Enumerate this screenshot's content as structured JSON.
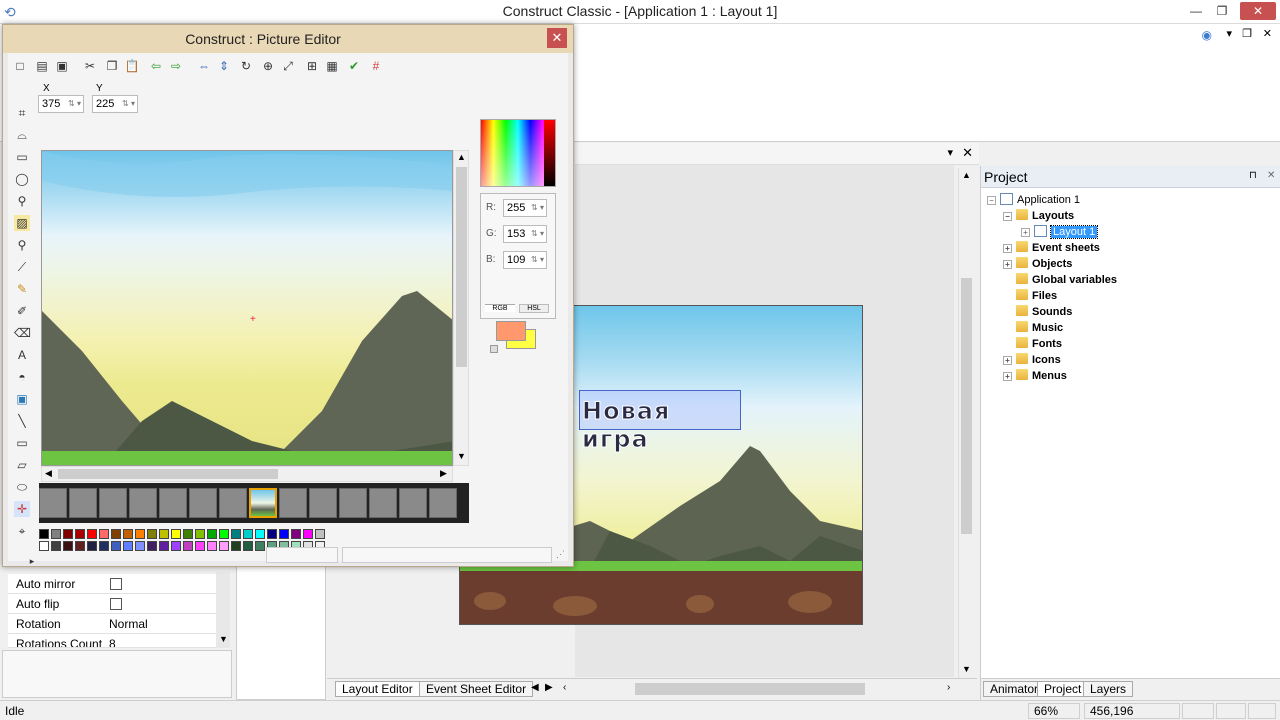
{
  "window": {
    "title": "Construct Classic - [Application 1 : Layout 1]",
    "minimize": "—",
    "maximize": "❐",
    "close": "✕"
  },
  "ribbon": {
    "help": "◉",
    "min": "▾",
    "restore": "❐",
    "close": "✕"
  },
  "picture_editor": {
    "title": "Construct : Picture Editor",
    "close": "✕",
    "x_label": "X",
    "x_value": "375",
    "y_label": "Y",
    "y_value": "225",
    "r_label": "R:",
    "r_value": "255",
    "g_label": "G:",
    "g_value": "153",
    "b_label": "B:",
    "b_value": "109",
    "tab_rgb": "RGB",
    "tab_hsl": "HSL",
    "primary_color": "#ff996d",
    "secondary_color": "#ffff44"
  },
  "layout": {
    "text_object": "Новая игра",
    "tabs": [
      "Layout Editor",
      "Event Sheet Editor"
    ]
  },
  "project": {
    "title": "Project",
    "pin": "⊓",
    "close": "✕",
    "root": "Application 1",
    "layouts": "Layouts",
    "layout1": "Layout 1",
    "folders": [
      "Event sheets",
      "Objects",
      "Global variables",
      "Files",
      "Sounds",
      "Music",
      "Fonts",
      "Icons",
      "Menus"
    ],
    "tabs": [
      "Animator",
      "Project",
      "Layers"
    ]
  },
  "properties": {
    "rows": [
      {
        "label": "Auto mirror",
        "value": ""
      },
      {
        "label": "Auto flip",
        "value": ""
      },
      {
        "label": "Rotation",
        "value": "Normal"
      },
      {
        "label": "Rotations Count",
        "value": "8"
      }
    ]
  },
  "status": {
    "text": "Idle",
    "zoom": "66%",
    "coords": "456,196"
  }
}
